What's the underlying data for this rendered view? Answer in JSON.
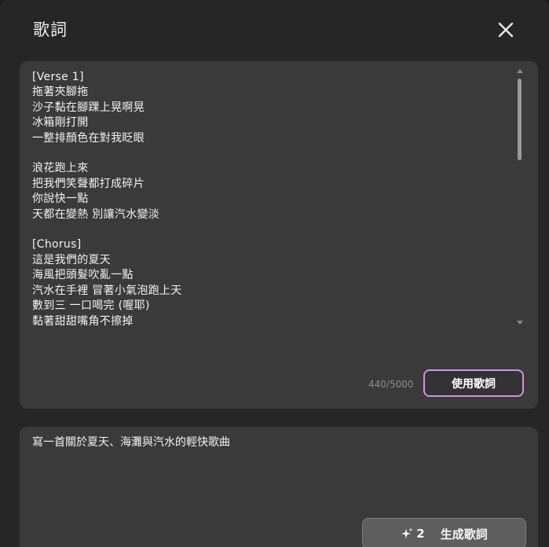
{
  "dialog": {
    "title": "歌詞",
    "close_icon": "close-icon"
  },
  "lyrics": {
    "text": "[Verse 1]\n拖著夾腳拖\n沙子黏在腳踝上晃啊晃\n冰箱剛打開\n一整排顏色在對我眨眼\n\n浪花跑上來\n把我們笑聲都打成碎片\n你說快一點\n天都在變熱 別讓汽水變淡\n\n[Chorus]\n這是我們的夏天\n海風把頭髮吹亂一點\n汽水在手裡 冒著小氣泡跑上天\n數到三 一口喝完 (喔耶)\n黏著甜甜嘴角不擦掉",
    "char_count": "440/5000",
    "use_button_label": "使用歌詞"
  },
  "prompt": {
    "text": "寫一首關於夏天、海灘與汽水的輕快歌曲",
    "generate_icon": "sparkle-icon",
    "generate_credits": "2",
    "generate_label": "生成歌詞"
  }
}
